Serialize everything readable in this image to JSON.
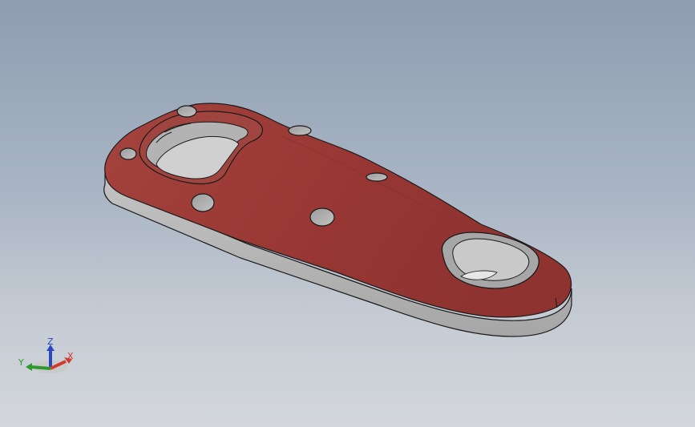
{
  "viewport": {
    "background_top": "#8e9db1",
    "background_bottom": "#d3d7dc"
  },
  "model": {
    "face_color": "#9b3a36",
    "face_highlight": "#b04a44",
    "side_color": "#b9b9b9",
    "edge_color": "#1a1a1a",
    "hole_color": "#a8a8a8"
  },
  "triad": {
    "x_label": "X",
    "y_label": "Y",
    "z_label": "Z",
    "x_color": "#d23a2e",
    "y_color": "#2d9a2d",
    "z_color": "#2b47c4"
  }
}
